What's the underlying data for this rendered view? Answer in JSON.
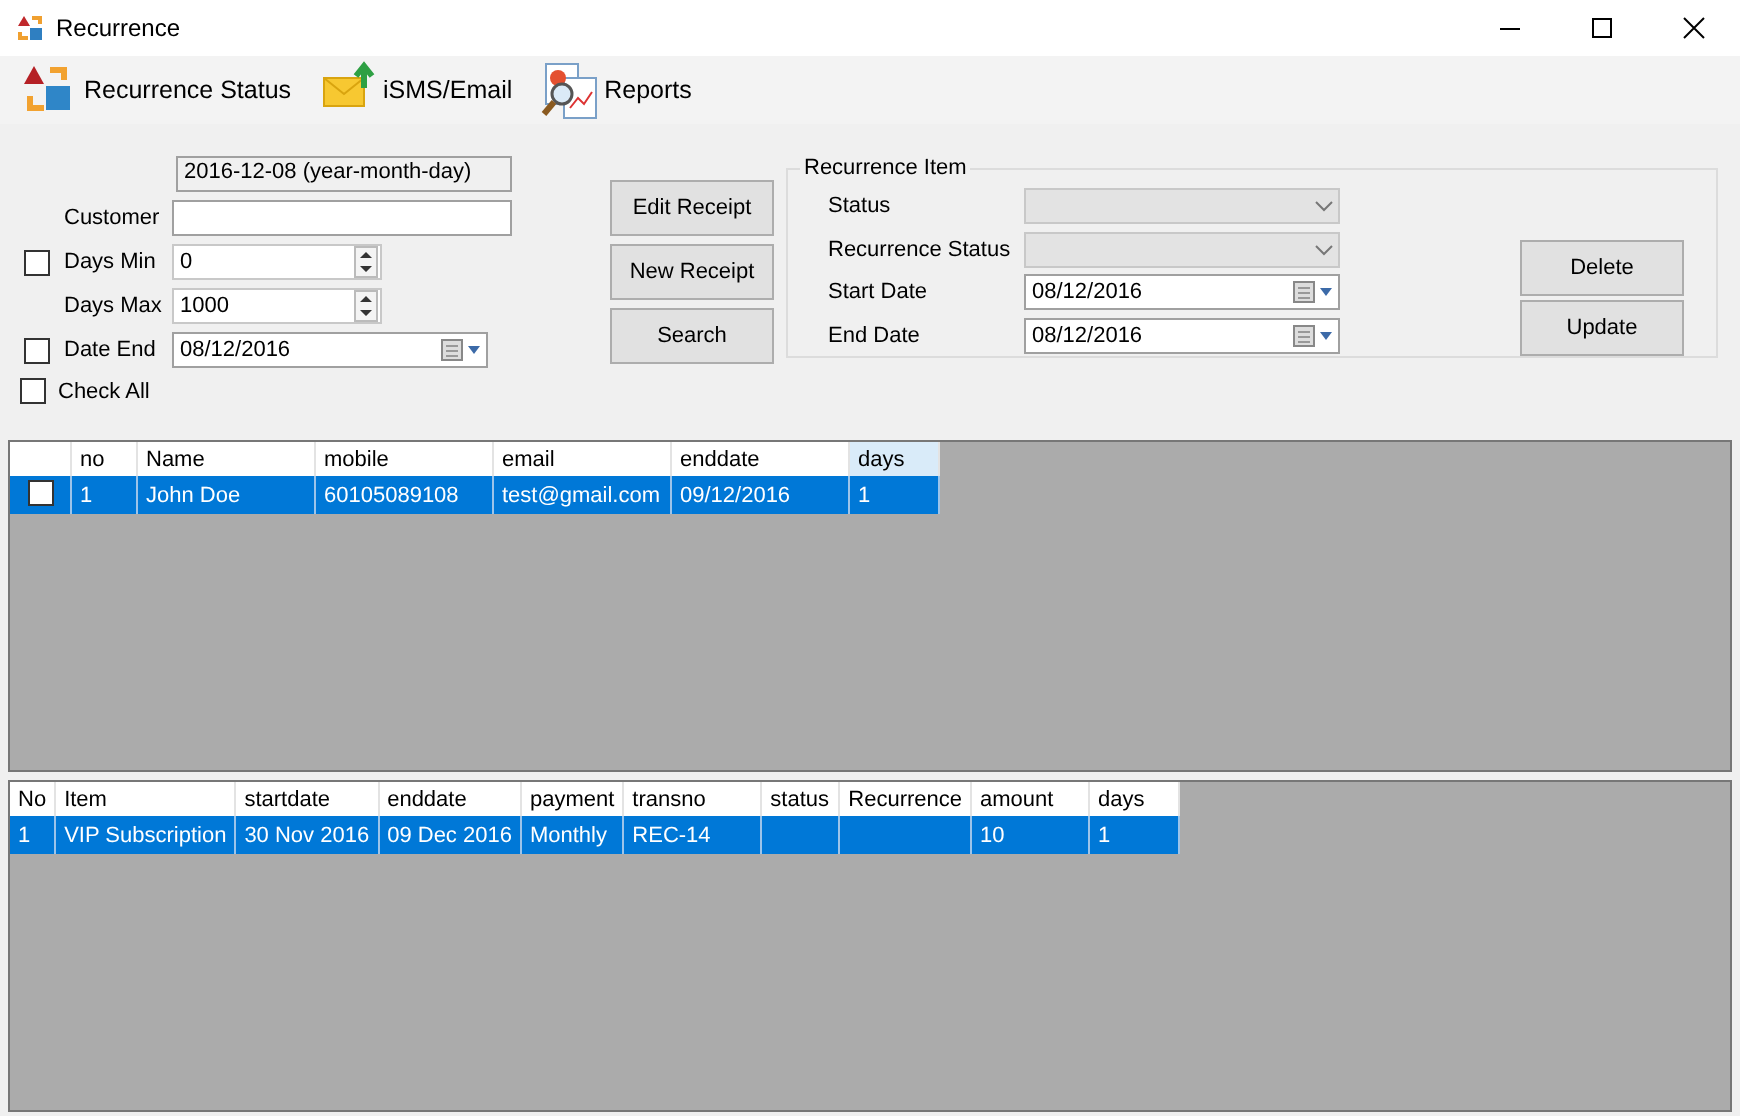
{
  "window": {
    "title": "Recurrence"
  },
  "toolbar": [
    {
      "label": "Recurrence Status",
      "kind": "status"
    },
    {
      "label": "iSMS/Email",
      "kind": "mail"
    },
    {
      "label": "Reports",
      "kind": "report"
    }
  ],
  "filter": {
    "date_display": "2016-12-08 (year-month-day)",
    "rows": [
      {
        "kind": "text",
        "label": "Customer"
      },
      {
        "kind": "spin",
        "label": "Days Min",
        "checked": false,
        "value": "0"
      },
      {
        "kind": "spin",
        "label": "Days Max",
        "value": "1000"
      },
      {
        "kind": "date",
        "label": "Date End",
        "checked": false,
        "value": "08/12/2016"
      }
    ],
    "check_all": {
      "label": "Check All",
      "checked": false
    }
  },
  "actions": [
    "Edit Receipt",
    "New Receipt",
    "Search"
  ],
  "recurrence_item": {
    "title": "Recurrence Item",
    "fields": [
      {
        "kind": "combo",
        "label": "Status"
      },
      {
        "kind": "combo",
        "label": "Recurrence Status"
      },
      {
        "kind": "date",
        "label": "Start Date",
        "value": "08/12/2016"
      },
      {
        "kind": "date",
        "label": "End Date",
        "value": "08/12/2016"
      }
    ],
    "buttons": [
      "Delete",
      "Update"
    ]
  },
  "customers_table": {
    "columns": [
      {
        "selected": false
      },
      {
        "label": "no",
        "selected": false
      },
      {
        "label": "Name",
        "selected": false
      },
      {
        "label": "mobile",
        "selected": false
      },
      {
        "label": "email",
        "selected": false
      },
      {
        "label": "enddate",
        "selected": false
      },
      {
        "label": "days",
        "selected": true
      }
    ],
    "rows": [
      {
        "selected": true,
        "checked": false,
        "cells": [
          "",
          "1",
          "John Doe",
          "60105089108",
          "test@gmail.com",
          "09/12/2016",
          "1"
        ]
      }
    ]
  },
  "items_table": {
    "columns": [
      {
        "label": "No",
        "selected": false
      },
      {
        "label": "Item",
        "selected": false
      },
      {
        "label": "startdate",
        "selected": false
      },
      {
        "label": "enddate",
        "selected": false
      },
      {
        "label": "payment",
        "selected": false
      },
      {
        "label": "transno",
        "selected": false
      },
      {
        "label": "status",
        "selected": false
      },
      {
        "label": "Recurrence",
        "selected": false
      },
      {
        "label": "amount",
        "selected": false
      },
      {
        "label": "days",
        "selected": false
      }
    ],
    "rows": [
      {
        "selected": true,
        "cells": [
          "1",
          "VIP Subscription",
          "30 Nov 2016",
          "09 Dec 2016",
          "Monthly",
          "REC-14",
          "",
          "",
          "10",
          "1"
        ]
      }
    ]
  }
}
